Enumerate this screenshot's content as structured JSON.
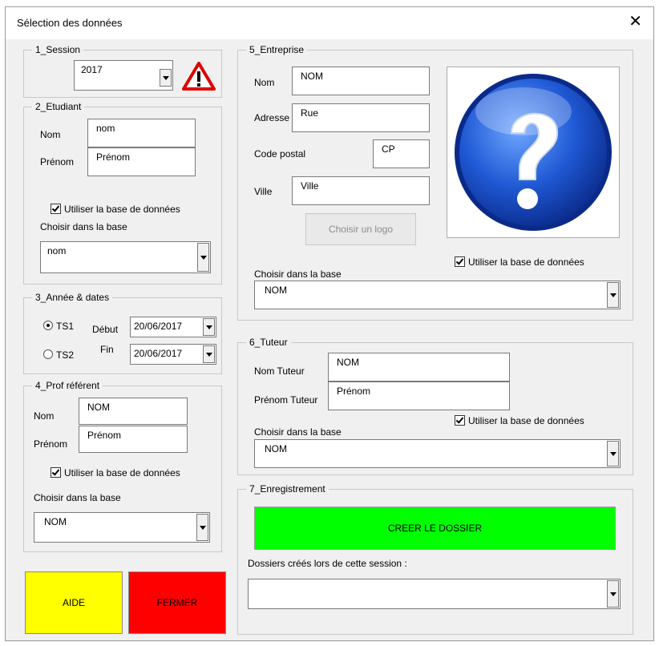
{
  "window": {
    "title": "Sélection des données",
    "close": "✕"
  },
  "session": {
    "legend": "1_Session",
    "year": "2017"
  },
  "etudiant": {
    "legend": "2_Etudiant",
    "nom_label": "Nom",
    "nom_value": "nom",
    "prenom_label": "Prénom",
    "prenom_value": "Prénom",
    "use_db": "Utiliser la base de données",
    "choose_label": "Choisir dans la base",
    "choose_value": "nom"
  },
  "annee": {
    "legend": "3_Année & dates",
    "ts1": "TS1",
    "ts2": "TS2",
    "debut_label": "Début",
    "debut_value": "20/06/2017",
    "fin_label": "Fin",
    "fin_value": "20/06/2017"
  },
  "prof": {
    "legend": "4_Prof référent",
    "nom_label": "Nom",
    "nom_value": "NOM",
    "prenom_label": "Prénom",
    "prenom_value": "Prénom",
    "use_db": "Utiliser la base de données",
    "choose_label": "Choisir dans la base",
    "choose_value": "NOM"
  },
  "entreprise": {
    "legend": "5_Entreprise",
    "nom_label": "Nom",
    "nom_value": "NOM",
    "adresse_label": "Adresse",
    "adresse_value": "Rue",
    "cp_label": "Code postal",
    "cp_value": "CP",
    "ville_label": "Ville",
    "ville_value": "Ville",
    "logo_button": "Choisir un logo",
    "use_db": "Utiliser la base de données",
    "choose_label": "Choisir dans la base",
    "choose_value": "NOM"
  },
  "tuteur": {
    "legend": "6_Tuteur",
    "nom_label": "Nom Tuteur",
    "nom_value": "NOM",
    "prenom_label": "Prénom Tuteur",
    "prenom_value": "Prénom",
    "use_db": "Utiliser la base de données",
    "choose_label": "Choisir dans la base",
    "choose_value": "NOM"
  },
  "enregistrement": {
    "legend": "7_Enregistrement",
    "create_button": "CREER LE DOSSIER",
    "dossiers_label": "Dossiers créés lors de cette session :",
    "dossiers_value": ""
  },
  "buttons": {
    "aide": "AIDE",
    "fermer": "FERMER"
  },
  "icons": {
    "warning": "warning-icon",
    "logo": "question-mark-icon"
  },
  "colors": {
    "create": "#00ff00",
    "aide": "#ffff00",
    "fermer": "#ff0000"
  }
}
